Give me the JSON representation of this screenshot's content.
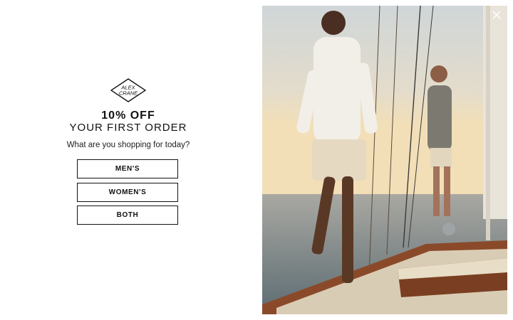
{
  "logo": {
    "line1": "ALEX",
    "line2": "CRANE"
  },
  "popup": {
    "offer": "10% OFF",
    "subhead": "YOUR FIRST ORDER",
    "question": "What are you shopping for today?",
    "buttons": {
      "mens": "MEN'S",
      "womens": "WOMEN'S",
      "both": "BOTH"
    }
  },
  "icons": {
    "close": "close-icon"
  },
  "colors": {
    "text": "#111111",
    "background": "#ffffff",
    "close_icon": "#ffffff"
  }
}
